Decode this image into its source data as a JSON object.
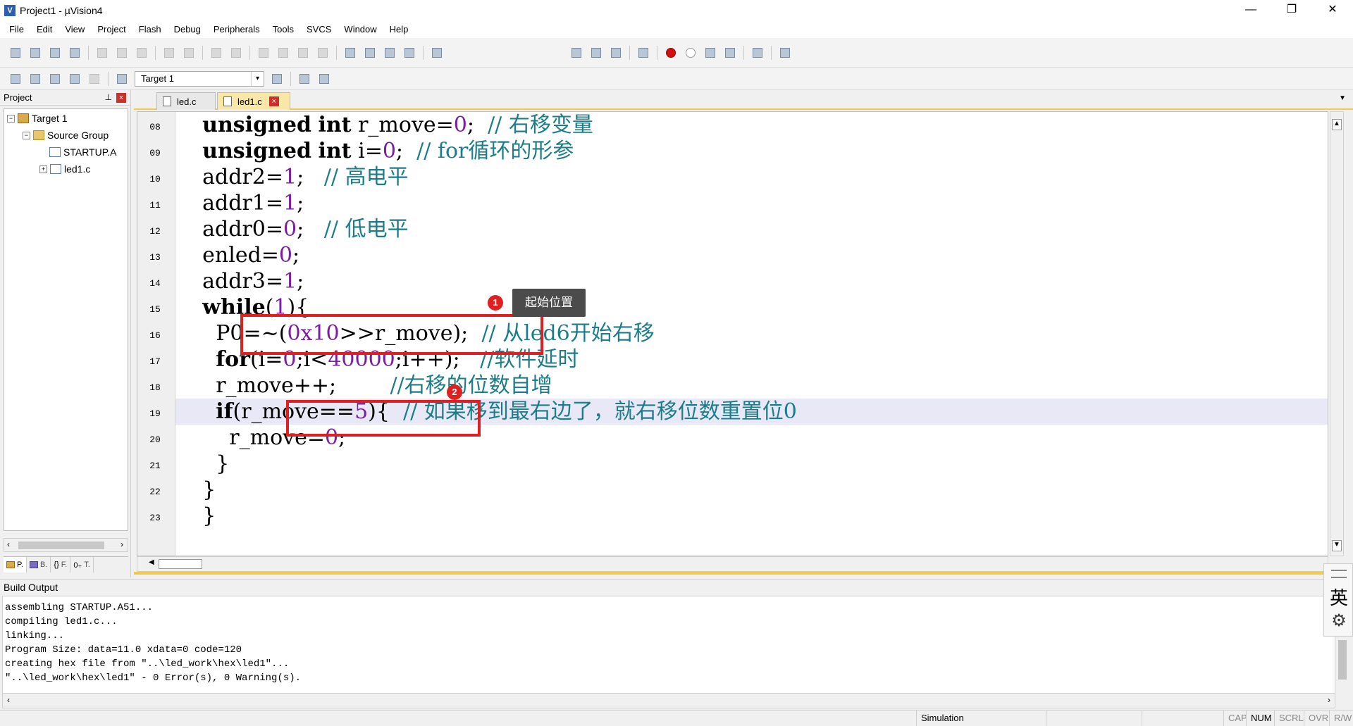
{
  "window": {
    "title": "Project1  - µVision4",
    "app_icon": "V",
    "controls": {
      "minimize": "—",
      "restore": "❐",
      "close": "✕"
    }
  },
  "menu": [
    "File",
    "Edit",
    "View",
    "Project",
    "Flash",
    "Debug",
    "Peripherals",
    "Tools",
    "SVCS",
    "Window",
    "Help"
  ],
  "toolbar2": {
    "target_select": "Target 1"
  },
  "project_panel": {
    "title": "Project",
    "pin_icon": "pin-icon",
    "tree": {
      "root": "Target 1",
      "group": "Source Group",
      "file1": "STARTUP.A",
      "file2": "led1.c"
    },
    "tabs": {
      "project": "P.",
      "books": "B.",
      "functions": "F.",
      "templates": "T."
    },
    "tab_glyphs": {
      "functions": "{}",
      "templates": "0₊"
    }
  },
  "editor": {
    "tabs": [
      {
        "label": "led.c"
      },
      {
        "label": "led1.c"
      }
    ],
    "line_numbers": [
      "08",
      "09",
      "10",
      "11",
      "12",
      "13",
      "14",
      "15",
      "16",
      "17",
      "18",
      "19",
      "20",
      "21",
      "22",
      "23"
    ],
    "lines": {
      "l08": {
        "indent": "    ",
        "kw1": "unsigned",
        "kw2": "int",
        "rest": "r_move=",
        "num": "0",
        "end": ";  ",
        "comment": "// 右移变量"
      },
      "l09": {
        "indent": "    ",
        "kw1": "unsigned",
        "kw2": "int",
        "rest": "i=",
        "num": "0",
        "end": ";  ",
        "comment": "// for循环的形参"
      },
      "l10": {
        "indent": "    ",
        "rest": "addr2=",
        "num": "1",
        "end": ";   ",
        "comment": "// 高电平"
      },
      "l11": {
        "indent": "    ",
        "rest": "addr1=",
        "num": "1",
        "end": ";"
      },
      "l12": {
        "indent": "    ",
        "rest": "addr0=",
        "num": "0",
        "end": ";   ",
        "comment": "// 低电平"
      },
      "l13": {
        "indent": "    ",
        "rest": "enled=",
        "num": "0",
        "end": ";"
      },
      "l14": {
        "indent": "    ",
        "rest": "addr3=",
        "num": "1",
        "end": ";"
      },
      "l15": {
        "indent": "    ",
        "kw": "while",
        "rest": "(",
        "num": "1",
        "end": "){"
      },
      "l16": {
        "indent": "      ",
        "rest": "P0=~(",
        "num": "0x10",
        "rest2": ">>r_move);",
        "gap": "  ",
        "comment": "// 从led6开始右移"
      },
      "l17": {
        "indent": "      ",
        "kw": "for",
        "rest": "(i=",
        "num": "0",
        "rest2": ";i<",
        "num2": "40000",
        "rest3": ";i++);",
        "gap": "   ",
        "comment": "//软件延时"
      },
      "l18": {
        "indent": "      ",
        "rest": "r_move++;",
        "gap": "        ",
        "comment": "//右移的位数自增"
      },
      "l19": {
        "indent": "      ",
        "kw": "if",
        "rest": "(r_move==",
        "num": "5",
        "rest2": "){",
        "gap": "  ",
        "comment": "// 如果移到最右边了，就右移位数重置位0"
      },
      "l20": {
        "indent": "        ",
        "rest": "r_move=",
        "num": "0",
        "end": ";"
      },
      "l21": {
        "indent": "      ",
        "rest": "}"
      },
      "l22": {
        "indent": "    ",
        "rest": "}"
      },
      "l23": {
        "indent": "    ",
        "rest": "}"
      }
    }
  },
  "annotations": {
    "badge1": "1",
    "badge2": "2",
    "tooltip": "起始位置",
    "color": "#e02020"
  },
  "build_output": {
    "title": "Build Output",
    "lines": [
      "assembling STARTUP.A51...",
      "compiling led1.c...",
      "linking...",
      "Program Size: data=11.0 xdata=0 code=120",
      "creating hex file from \"..\\led_work\\hex\\led1\"...",
      "\"..\\led_work\\hex\\led1\" - 0 Error(s), 0 Warning(s)."
    ]
  },
  "ime": {
    "lang": "英",
    "settings_icon": "⚙"
  },
  "statusbar": {
    "mode": "Simulation",
    "cap": "CAP",
    "num": "NUM",
    "scrl": "SCRL",
    "ovr": "OVR",
    "rw": "R/W"
  },
  "colors": {
    "keyword": "#000000",
    "number": "#7a1fa2",
    "comment": "#1c7d8a",
    "active_tab": "#f9e7a7",
    "current_line": "#e8e8f6"
  }
}
